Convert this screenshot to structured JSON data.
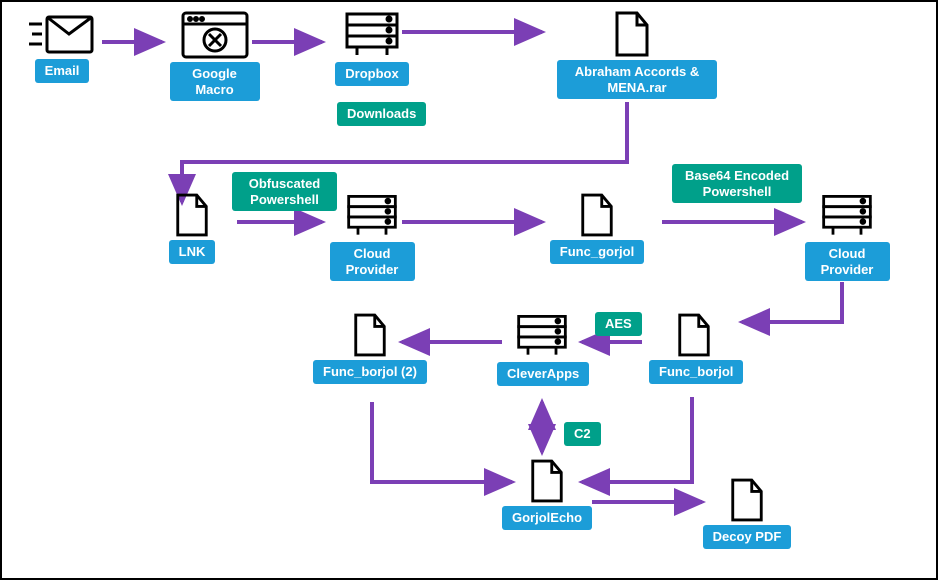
{
  "nodes": {
    "email": {
      "label": "Email"
    },
    "google_macro": {
      "label": "Google Macro"
    },
    "dropbox": {
      "label": "Dropbox"
    },
    "rar": {
      "label": "Abraham Accords & MENA.rar"
    },
    "downloads": {
      "label": "Downloads"
    },
    "lnk": {
      "label": "LNK"
    },
    "obf_ps": {
      "label": "Obfuscated Powershell"
    },
    "cloud1": {
      "label": "Cloud Provider"
    },
    "func_gorjol": {
      "label": "Func_gorjol"
    },
    "b64_ps": {
      "label": "Base64 Encoded Powershell"
    },
    "cloud2": {
      "label": "Cloud Provider"
    },
    "aes": {
      "label": "AES"
    },
    "func_borjol": {
      "label": "Func_borjol"
    },
    "cleverapps": {
      "label": "CleverApps"
    },
    "func_borjol2": {
      "label": "Func_borjol (2)"
    },
    "c2": {
      "label": "C2"
    },
    "gorjolecho": {
      "label": "GorjolEcho"
    },
    "decoy": {
      "label": "Decoy PDF"
    }
  },
  "colors": {
    "arrow": "#7b3fb5",
    "blue": "#1c9dd8",
    "green": "#00a08a"
  }
}
